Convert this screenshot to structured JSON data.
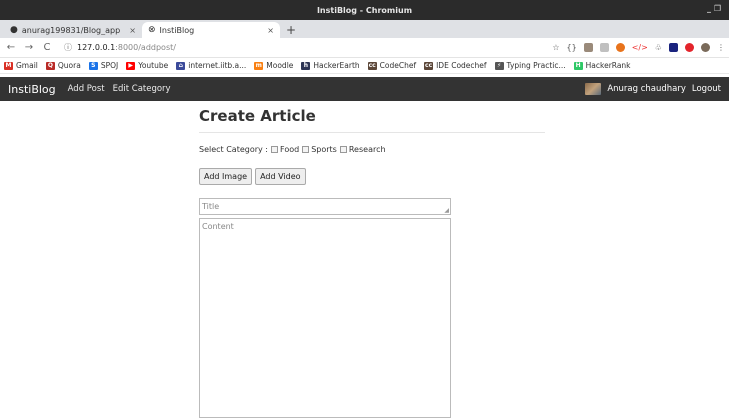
{
  "window": {
    "title": "InstiBlog - Chromium",
    "controls": "_ ❐"
  },
  "tabs": [
    {
      "icon": "github-icon",
      "glyph": "●",
      "title": "anurag199831/Blog_app",
      "close": "×",
      "active": false
    },
    {
      "icon": "globe-icon",
      "glyph": "⊗",
      "title": "InstiBlog",
      "close": "×",
      "active": true
    }
  ],
  "toolbar": {
    "back": "←",
    "forward": "→",
    "reload": "C",
    "url_host": "127.0.0.1",
    "url_path": ":8000/addpost/",
    "star": "☆"
  },
  "bookmarks": [
    {
      "label": "Gmail",
      "glyph": "M",
      "color": "#d93025"
    },
    {
      "label": "Quora",
      "glyph": "Q",
      "color": "#b92b27"
    },
    {
      "label": "SPOJ",
      "glyph": "S",
      "color": "#1a73e8"
    },
    {
      "label": "Youtube",
      "glyph": "▶",
      "color": "#ff0000"
    },
    {
      "label": "internet.iitb.a...",
      "glyph": "⌂",
      "color": "#3b4a9a"
    },
    {
      "label": "Moodle",
      "glyph": "m",
      "color": "#f98012"
    },
    {
      "label": "HackerEarth",
      "glyph": "h",
      "color": "#2c3454"
    },
    {
      "label": "CodeChef",
      "glyph": "cc",
      "color": "#5b4638"
    },
    {
      "label": "IDE Codechef",
      "glyph": "cc",
      "color": "#5b4638"
    },
    {
      "label": "Typing Practic...",
      "glyph": "⚡",
      "color": "#555555"
    },
    {
      "label": "HackerRank",
      "glyph": "H",
      "color": "#2ec866"
    }
  ],
  "app": {
    "brand": "InstiBlog",
    "links": [
      "Add Post",
      "Edit Category"
    ],
    "user": "Anurag chaudhary",
    "logout": "Logout"
  },
  "form": {
    "heading": "Create Article",
    "category_label": "Select Category :",
    "categories": [
      "Food",
      "Sports",
      "Research"
    ],
    "add_image": "Add Image",
    "add_video": "Add Video",
    "title_placeholder": "Title",
    "content_placeholder": "Content"
  }
}
